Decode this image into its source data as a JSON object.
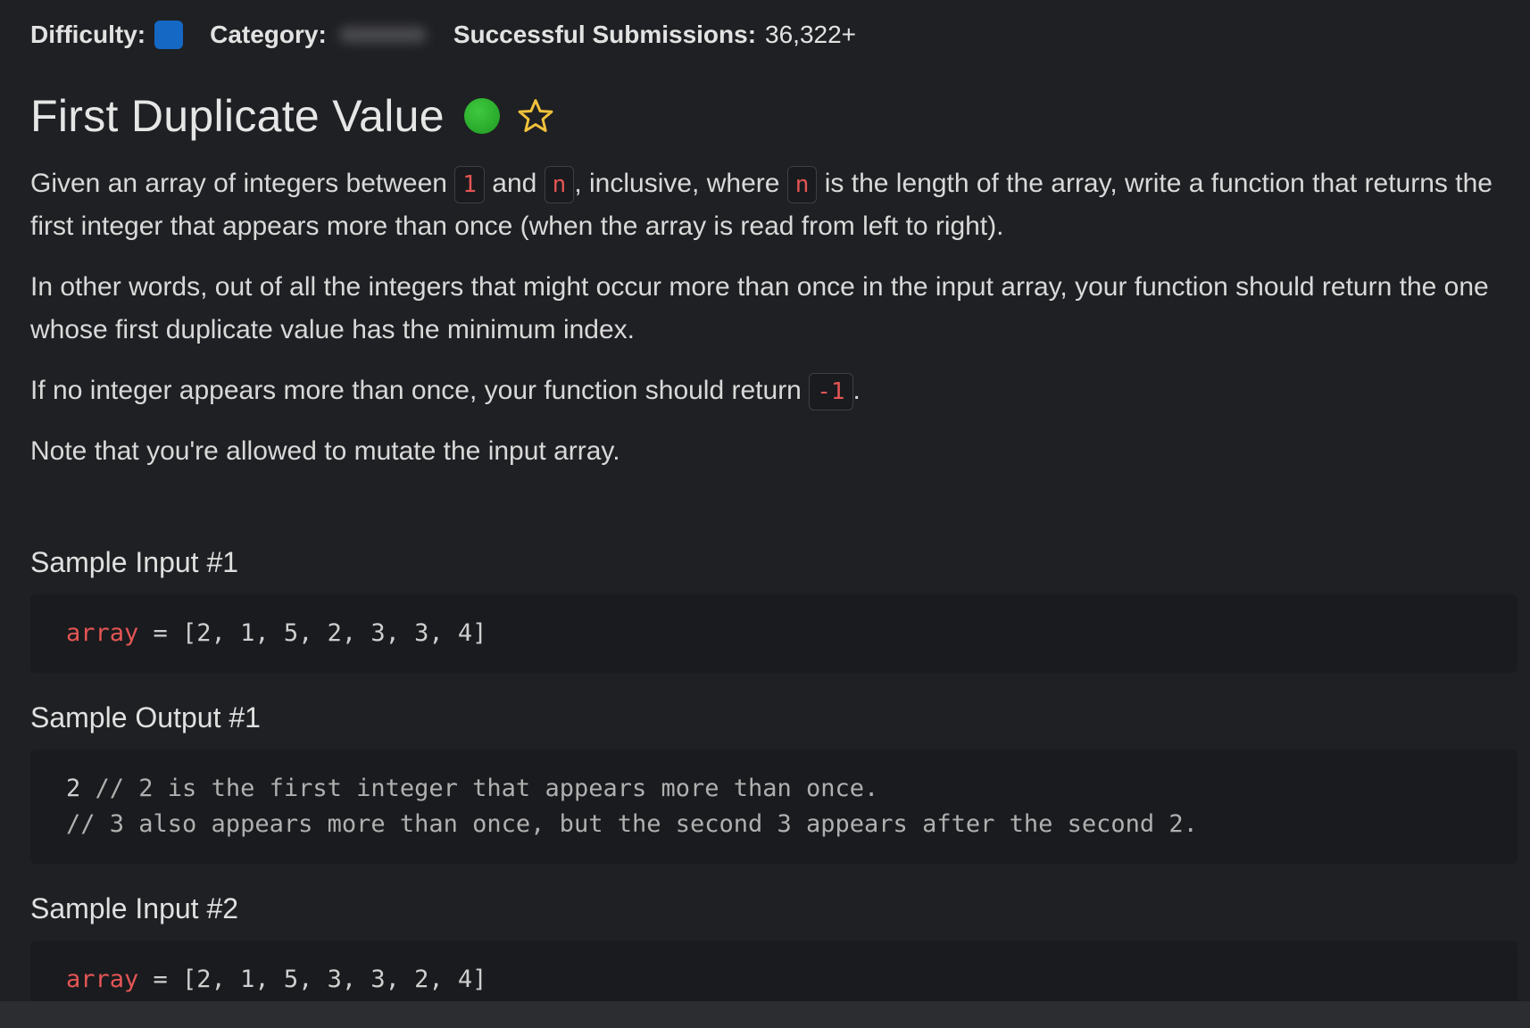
{
  "meta": {
    "difficulty_label": "Difficulty:",
    "category_label": "Category:",
    "submissions_label": "Successful Submissions:",
    "submissions_value": "36,322+",
    "difficulty_color": "#1568c4"
  },
  "title": "First Duplicate Value",
  "description": {
    "p1_a": "Given an array of integers between ",
    "p1_code1": "1",
    "p1_b": " and ",
    "p1_code2": "n",
    "p1_c": ", inclusive, where ",
    "p1_code3": "n",
    "p1_d": " is the length of the array, write a function that returns the first integer that appears more than once (when the array is read from left to right).",
    "p2": "In other words, out of all the integers that might occur more than once in the input array, your function should return the one whose first duplicate value has the minimum index.",
    "p3_a": "If no integer appears more than once, your function should return ",
    "p3_code": "-1",
    "p3_b": ".",
    "p4": "Note that you're allowed to mutate the input array."
  },
  "samples": {
    "input1_heading": "Sample Input #1",
    "input1_var": "array",
    "input1_rest": " = [2, 1, 5, 2, 3, 3, 4]",
    "output1_heading": "Sample Output #1",
    "output1_line1_value": "2",
    "output1_line1_comment": " // 2 is the first integer that appears more than once.",
    "output1_line2_comment": "// 3 also appears more than once, but the second 3 appears after the second 2.",
    "input2_heading": "Sample Input #2",
    "input2_var": "array",
    "input2_rest": " = [2, 1, 5, 3, 3, 2, 4]"
  }
}
